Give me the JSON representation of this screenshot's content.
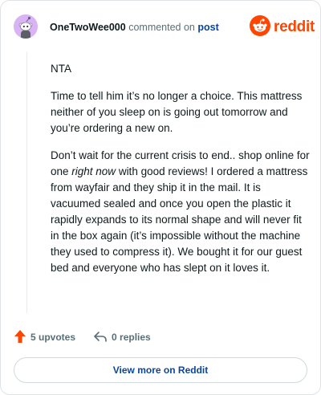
{
  "header": {
    "username": "OneTwoWee000",
    "action_text": "commented on",
    "post_link": "post",
    "brand": "reddit"
  },
  "comment": {
    "para1": "NTA",
    "para2": "Time to tell him it’s no longer a choice. This mattress neither of you sleep on is going out tomorrow and you’re ordering a new on.",
    "para3_a": "Don’t wait for the current crisis to end.. shop online for one ",
    "para3_em": "right now",
    "para3_b": " with good reviews! I ordered a mattress from wayfair and they ship it in the mail. It is vacuumed sealed and once you open the plastic it rapidly expands to its normal shape and will never fit in the box again (it’s impossible without the machine they used to compress it). We bought it for our guest bed and everyone who has slept on it loves it."
  },
  "footer": {
    "upvotes": "5 upvotes",
    "replies": "0 replies",
    "view_more": "View more on Reddit"
  },
  "colors": {
    "brand": "#ff4500",
    "link": "#0a449b",
    "avatar_bg": "#d9b4f4"
  },
  "icons": [
    "snoo-avatar-icon",
    "reddit-logo-icon",
    "upvote-arrow-icon",
    "reply-icon"
  ]
}
